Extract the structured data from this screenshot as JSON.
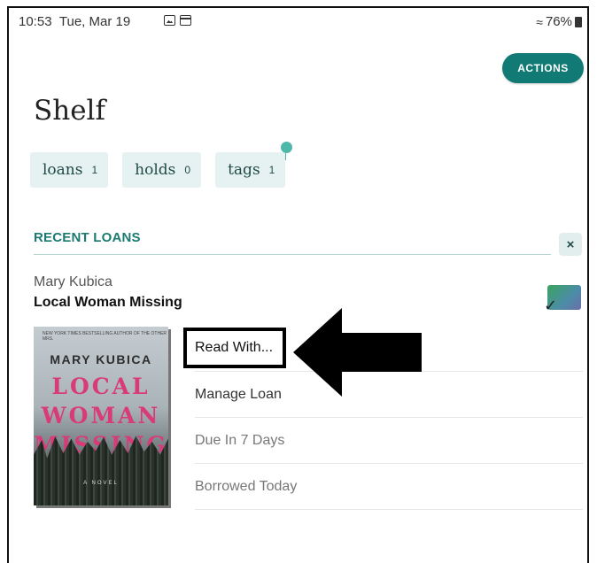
{
  "status_bar": {
    "time": "10:53",
    "date": "Tue, Mar 19",
    "battery": "76%",
    "icons": [
      "image-icon",
      "calendar-icon",
      "wifi-icon",
      "battery-icon"
    ]
  },
  "header": {
    "actions_label": "ACTIONS",
    "title": "Shelf"
  },
  "tabs": [
    {
      "label": "loans",
      "count": "1"
    },
    {
      "label": "holds",
      "count": "0"
    },
    {
      "label": "tags",
      "count": "1"
    }
  ],
  "recent_loans": {
    "section_title": "RECENT LOANS",
    "dismiss_label": "×",
    "book": {
      "author": "Mary Kubica",
      "title": "Local Woman Missing",
      "cover": {
        "tagline": "NEW YORK TIMES BESTSELLING AUTHOR OF THE OTHER MRS.",
        "author_name": "MARY KUBICA",
        "words": [
          "LOCAL",
          "WOMAN",
          "MISSING"
        ],
        "novel": "A NOVEL"
      }
    },
    "menu": [
      {
        "label": "Read With..."
      },
      {
        "label": "Manage Loan"
      },
      {
        "label": "Due In 7 Days"
      },
      {
        "label": "Borrowed Today"
      }
    ]
  },
  "colors": {
    "accent": "#117a74",
    "tab_bg": "#e6f2f1",
    "section_title": "#1b7a72"
  }
}
